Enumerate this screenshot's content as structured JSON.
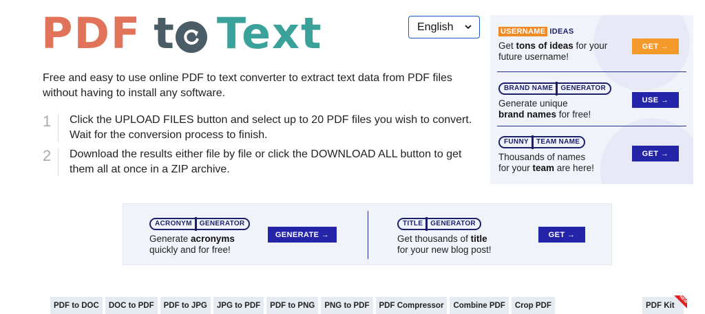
{
  "logo": {
    "part1": "PDF",
    "part2": "t",
    "part3": "Text"
  },
  "language": {
    "selected": "English"
  },
  "intro": "Free and easy to use online PDF to text converter to extract text data from PDF files without having to install any software.",
  "steps": [
    {
      "num": "1",
      "text": "Click the UPLOAD FILES button and select up to 20 PDF files you wish to convert. Wait for the conversion process to finish."
    },
    {
      "num": "2",
      "text": "Download the results either file by file or click the DOWNLOAD ALL button to get them all at once in a ZIP archive."
    }
  ],
  "side_ad": {
    "username": {
      "tag_a": "USERNAME",
      "tag_b": "IDEAS",
      "line1_pre": "Get ",
      "line1_bold": "tons of ideas",
      "line1_post": " for your",
      "line2": "future username!",
      "button": "GET →"
    },
    "brand": {
      "tag_a": "BRAND NAME",
      "tag_b": "GENERATOR",
      "line1": "Generate unique",
      "line2_bold": "brand names",
      "line2_post": " for free!",
      "button": "USE →"
    },
    "team": {
      "tag_a": "FUNNY",
      "tag_b": "TEAM NAME",
      "line1": "Thousands of names",
      "line2_pre": "for your ",
      "line2_bold": "team",
      "line2_post": " are here!",
      "button": "GET →"
    }
  },
  "mid_ad": {
    "acronym": {
      "tag_a": "ACRONYM",
      "tag_b": "GENERATOR",
      "line1_pre": "Generate ",
      "line1_bold": "acronyms",
      "line2": "quickly and for free!",
      "button": "GENERATE →"
    },
    "title": {
      "tag_a": "TITLE",
      "tag_b": "GENERATOR",
      "line1_pre": "Get thousands of ",
      "line1_bold": "title",
      "line2": "for your new blog post!",
      "button": "GET →"
    }
  },
  "tools": [
    "PDF to DOC",
    "DOC to PDF",
    "PDF to JPG",
    "JPG to PDF",
    "PDF to PNG",
    "PNG to PDF",
    "PDF Compressor",
    "Combine PDF",
    "Crop PDF"
  ],
  "tool_right": "PDF Kit",
  "new_flag": "NEW",
  "colors": {
    "logo_pdf": "#e2735b",
    "logo_to": "#4a5d66",
    "logo_text": "#3aa29a",
    "accent_navy": "#2324a8",
    "accent_orange": "#f39a2a"
  }
}
